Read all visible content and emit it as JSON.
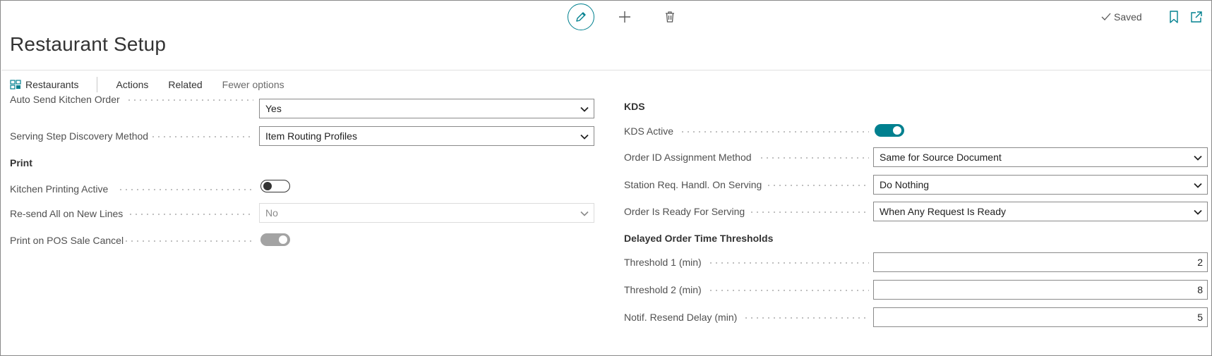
{
  "header": {
    "saved_label": "Saved",
    "page_title": "Restaurant Setup"
  },
  "ribbon": {
    "restaurants": "Restaurants",
    "actions": "Actions",
    "related": "Related",
    "fewer_options": "Fewer options"
  },
  "left": {
    "auto_send": {
      "label": "Auto Send Kitchen Order",
      "value": "Yes"
    },
    "serving_step": {
      "label": "Serving Step Discovery Method",
      "value": "Item Routing Profiles"
    },
    "print_group": "Print",
    "kitchen_printing": {
      "label": "Kitchen Printing Active",
      "value": "off"
    },
    "resend_all": {
      "label": "Re-send All on New Lines",
      "value": "No"
    },
    "print_on_cancel": {
      "label": "Print on POS Sale Cancel",
      "value": "on"
    }
  },
  "right": {
    "kds_group": "KDS",
    "kds_active": {
      "label": "KDS Active",
      "value": "on"
    },
    "order_id": {
      "label": "Order ID Assignment Method",
      "value": "Same for Source Document"
    },
    "station_req": {
      "label": "Station Req. Handl. On Serving",
      "value": "Do Nothing"
    },
    "order_ready": {
      "label": "Order Is Ready For Serving",
      "value": "When Any Request Is Ready"
    },
    "delayed_group": "Delayed Order Time Thresholds",
    "threshold1": {
      "label": "Threshold 1 (min)",
      "value": "2"
    },
    "threshold2": {
      "label": "Threshold 2 (min)",
      "value": "8"
    },
    "notif_delay": {
      "label": "Notif. Resend Delay (min)",
      "value": "5"
    }
  },
  "colors": {
    "accent": "#00808f",
    "toggle_disabled": "#a3a3a3"
  },
  "icons": [
    "pencil-icon",
    "plus-icon",
    "trash-icon",
    "check-icon",
    "bookmark-icon",
    "popout-icon",
    "restaurants-icon",
    "chevron-down-icon"
  ]
}
